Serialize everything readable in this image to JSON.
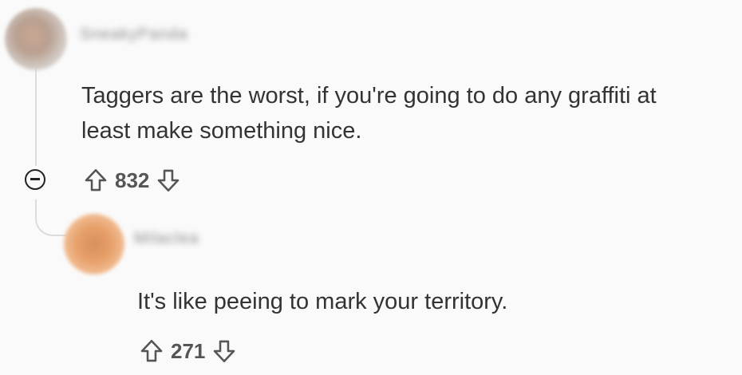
{
  "comments": [
    {
      "username": "SneakyPanda",
      "body": [
        "Taggers are the worst, if you're going to do any graffiti at",
        "least make something nice."
      ],
      "score": "832"
    },
    {
      "username": "Milaclea",
      "body": [
        "It's like peeing to mark your territory."
      ],
      "score": "271"
    }
  ],
  "icons": {
    "collapse": "minus-circle-icon",
    "upvote": "arrow-up-icon",
    "downvote": "arrow-down-icon"
  }
}
